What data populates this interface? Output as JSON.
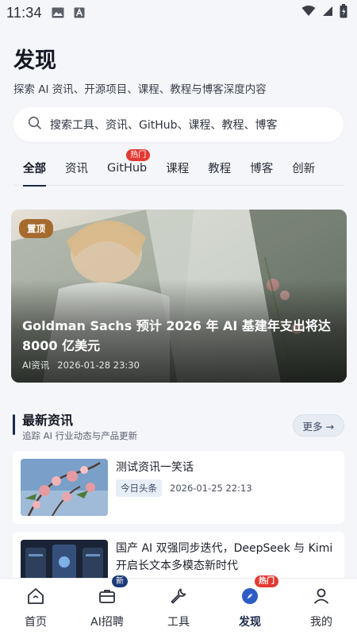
{
  "status_bar": {
    "time": "11:34"
  },
  "header": {
    "title": "发现",
    "subtitle": "探索 AI 资讯、开源项目、课程、教程与博客深度内容"
  },
  "search": {
    "placeholder": "搜索工具、资讯、GitHub、课程、教程、博客"
  },
  "tabs": [
    {
      "label": "全部",
      "active": true
    },
    {
      "label": "资讯"
    },
    {
      "label": "GitHub",
      "badge": "热门"
    },
    {
      "label": "课程"
    },
    {
      "label": "教程"
    },
    {
      "label": "博客"
    },
    {
      "label": "创新"
    }
  ],
  "hero": {
    "badge": "置顶",
    "title": "Goldman Sachs 预计 2026 年 AI 基建年支出将达 8000 亿美元",
    "category": "AI资讯",
    "datetime": "2026-01-28 23:30"
  },
  "latest": {
    "title": "最新资讯",
    "subtitle": "追踪 AI 行业动态与产品更新",
    "more": "更多 →",
    "items": [
      {
        "title": "测试资讯一笑话",
        "source": "今日头条",
        "datetime": "2026-01-25 22:13"
      },
      {
        "title": "国产 AI 双强同步迭代，DeepSeek 与 Kimi 开启长文本多模态新时代"
      }
    ]
  },
  "bottom_nav": [
    {
      "label": "首页",
      "icon": "home-icon"
    },
    {
      "label": "AI招聘",
      "icon": "briefcase-icon",
      "badge": "新"
    },
    {
      "label": "工具",
      "icon": "wrench-icon"
    },
    {
      "label": "发现",
      "icon": "compass-icon",
      "badge": "热门",
      "active": true
    },
    {
      "label": "我的",
      "icon": "user-icon"
    }
  ],
  "colors": {
    "accent": "#1b2a4a",
    "hot": "#e23a32",
    "pin": "#a56a2e",
    "background": "#f4f6f9"
  }
}
